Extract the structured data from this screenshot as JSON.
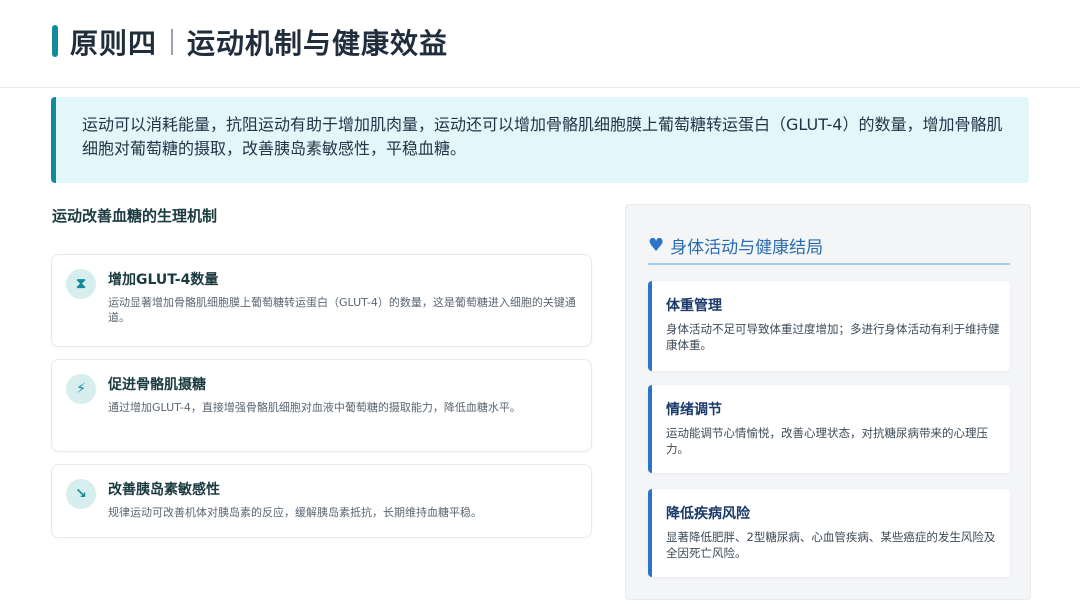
{
  "header": {
    "title_part1": "原则四",
    "title_part2": "运动机制与健康效益"
  },
  "intro": {
    "text": "运动可以消耗能量，抗阻运动有助于增加肌肉量，运动还可以增加骨骼肌细胞膜上葡萄糖转运蛋白（GLUT-4）的数量，增加骨骼肌细胞对葡萄糖的摄取，改善胰岛素敏感性，平稳血糖。"
  },
  "mechanisms": {
    "title": "运动改善血糖的生理机制",
    "items": [
      {
        "icon": "hourglass-icon",
        "glyph": "⧗",
        "title": "增加GLUT-4数量",
        "desc": "运动显著增加骨骼肌细胞膜上葡萄糖转运蛋白（GLUT-4）的数量，这是葡萄糖进入细胞的关键通道。"
      },
      {
        "icon": "lightning-icon",
        "glyph": "⚡",
        "title": "促进骨骼肌摄糖",
        "desc": "通过增加GLUT-4，直接增强骨骼肌细胞对血液中葡萄糖的摄取能力，降低血糖水平。"
      },
      {
        "icon": "trend-down-icon",
        "glyph": "↘",
        "title": "改善胰岛素敏感性",
        "desc": "规律运动可改善机体对胰岛素的反应，缓解胰岛素抵抗，长期维持血糖平稳。"
      }
    ]
  },
  "outcomes": {
    "icon": "heartbeat-icon",
    "title": "身体活动与健康结局",
    "items": [
      {
        "title": "体重管理",
        "desc": "身体活动不足可导致体重过度增加；多进行身体活动有利于维持健康体重。"
      },
      {
        "title": "情绪调节",
        "desc": "运动能调节心情愉悦，改善心理状态，对抗糖尿病带来的心理压力。"
      },
      {
        "title": "降低疾病风险",
        "desc": "显著降低肥胖、2型糖尿病、心血管疾病、某些癌症的发生风险及全因死亡风险。"
      }
    ]
  },
  "colors": {
    "accent_teal": "#138a9b",
    "accent_blue": "#2b74c6",
    "intro_bg": "#e3f6f9"
  }
}
